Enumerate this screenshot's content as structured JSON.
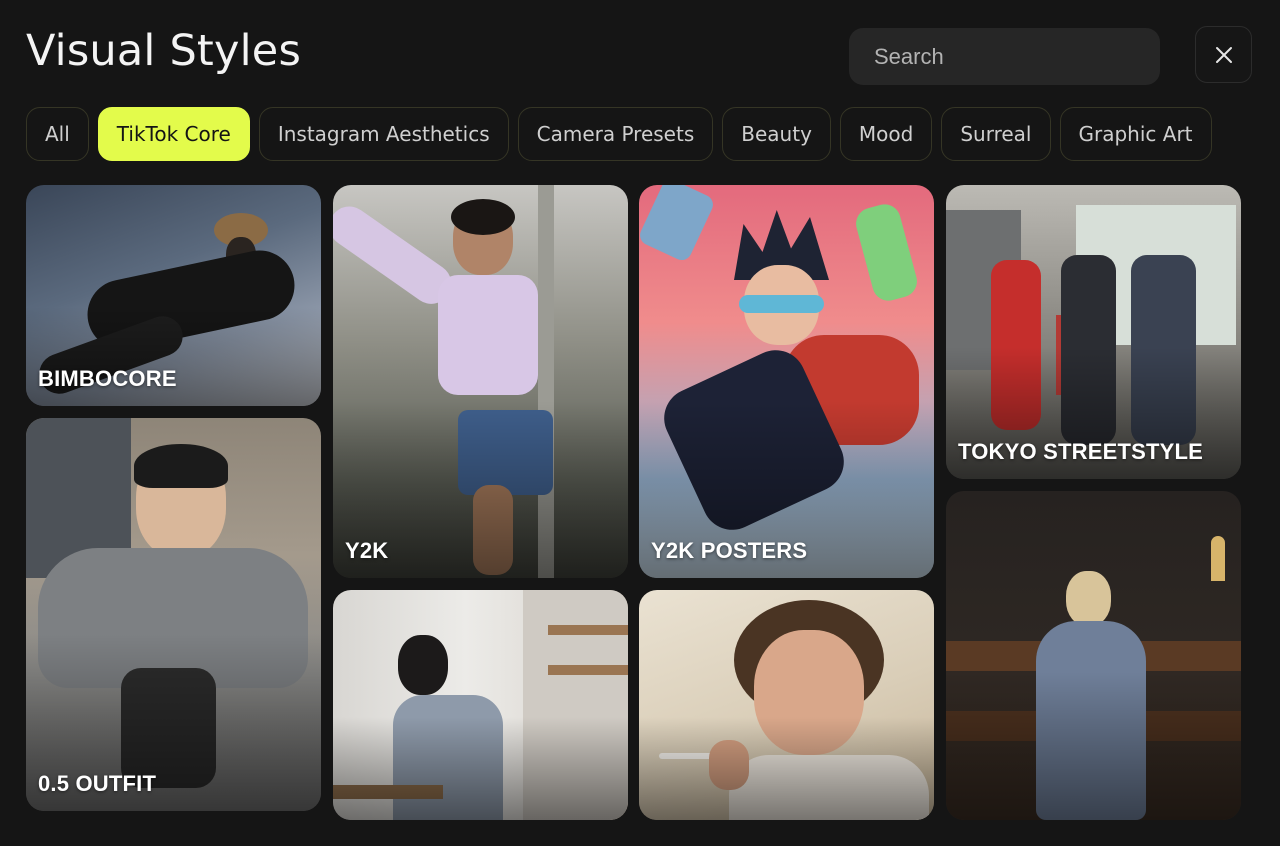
{
  "header": {
    "title": "Visual Styles",
    "search_placeholder": "Search",
    "close_icon": "close-icon"
  },
  "filters": [
    {
      "label": "All",
      "active": false
    },
    {
      "label": "TikTok Core",
      "active": true
    },
    {
      "label": "Instagram Aesthetics",
      "active": false
    },
    {
      "label": "Camera Presets",
      "active": false
    },
    {
      "label": "Beauty",
      "active": false
    },
    {
      "label": "Mood",
      "active": false
    },
    {
      "label": "Surreal",
      "active": false
    },
    {
      "label": "Graphic Art",
      "active": false
    }
  ],
  "cards": [
    {
      "label": "BIMBOCORE"
    },
    {
      "label": "0.5 OUTFIT"
    },
    {
      "label": "Y2K"
    },
    {
      "label": ""
    },
    {
      "label": "Y2K POSTERS"
    },
    {
      "label": ""
    },
    {
      "label": "TOKYO STREETSTYLE"
    },
    {
      "label": ""
    }
  ],
  "colors": {
    "background": "#151515",
    "accent": "#e3fb4b",
    "search_bg": "#262626"
  }
}
